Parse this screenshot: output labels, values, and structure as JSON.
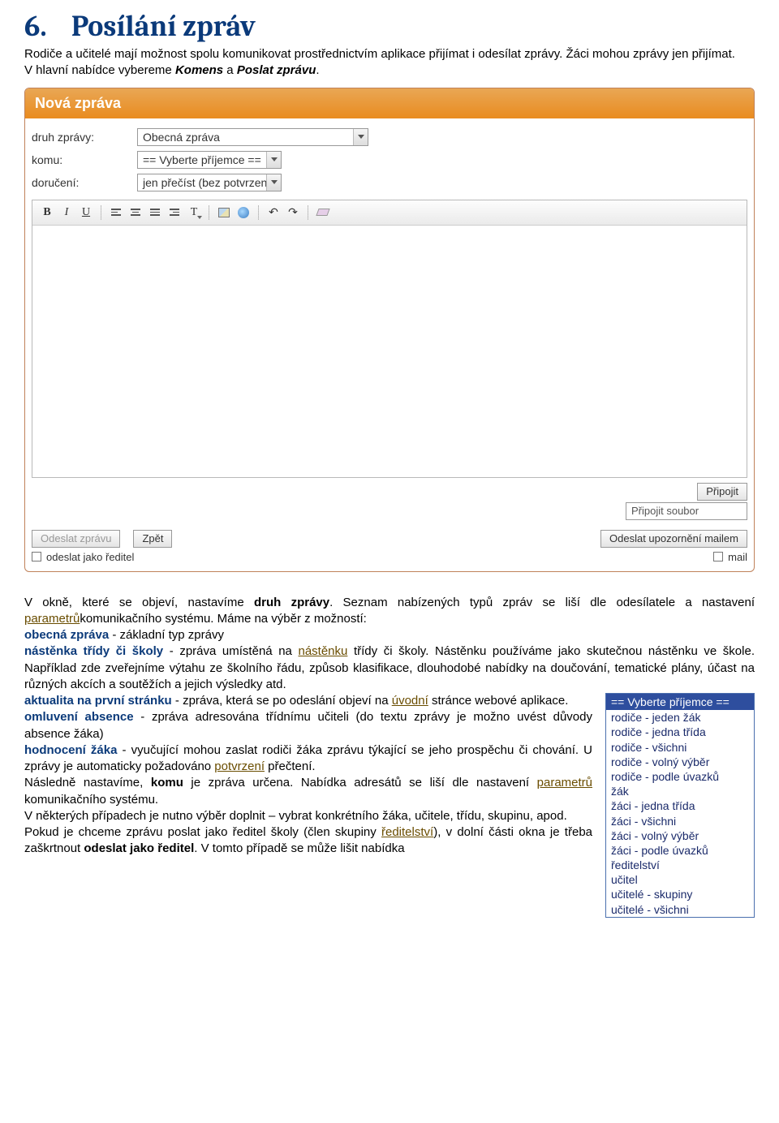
{
  "heading": {
    "number": "6.",
    "title": "Posílání zpráv"
  },
  "intro": {
    "p1a": "Rodiče a učitelé mají možnost spolu komunikovat prostřednictvím aplikace přijímat i odesílat zprávy. Žáci mohou zprávy jen přijímat.",
    "p1b_prefix": "V hlavní nabídce vybereme ",
    "p1b_bold1": "Komens",
    "p1b_mid": " a ",
    "p1b_bold2": "Poslat zprávu",
    "p1b_suffix": "."
  },
  "app": {
    "header_title": "Nová zpráva",
    "labels": {
      "druh": "druh zprávy:",
      "komu": "komu:",
      "doruceni": "doručení:"
    },
    "values": {
      "druh": "Obecná zpráva",
      "komu": "== Vyberte příjemce ==",
      "doruceni": "jen přečíst (bez potvrzení"
    },
    "toolbar": {
      "bold": "B",
      "italic": "I",
      "underline": "U",
      "text_style": "T",
      "undo": "↶",
      "redo": "↷"
    },
    "attach": {
      "btn": "Připojit",
      "field": "Připojit soubor"
    },
    "bottom": {
      "send": "Odeslat zprávu",
      "back": "Zpět",
      "as_director": "odeslat jako ředitel",
      "send_mail": "Odeslat upozornění mailem",
      "mail": "mail"
    }
  },
  "explain": {
    "l1a": "V okně, které se objeví, nastavíme ",
    "l1b": "druh zprávy",
    "l1c": ". Seznam nabízených typů zpráv se liší dle odesílatele a nastavení ",
    "l1d": "parametrů",
    "l1e": "komunikačního systému. Máme na výběr z možností:",
    "obecna_b": "obecná zpráva",
    "obecna_t": " - základní typ zprávy",
    "nastenka_b": "nástěnka třídy či školy",
    "nastenka_t1": " - zpráva umístěná na ",
    "nastenka_l": "nástěnku",
    "nastenka_t2": " třídy či školy. Nástěnku používáme jako skutečnou nástěnku ve škole. Například zde zveřejníme výtahu ze školního řádu, způsob klasifikace, dlouhodobé nabídky na doučování, tematické plány, účast na různých akcích a soutěžích a jejich výsledky atd.",
    "aktual_b": "aktualita na první stránku",
    "aktual_t1": " - zpráva, která se po odeslání objeví na ",
    "aktual_l": "úvodní",
    "aktual_t2": " stránce webové aplikace.",
    "omluv_b": "omluvení absence",
    "omluv_t": " - zpráva adresována třídnímu učiteli (do textu zprávy je možno uvést důvody absence žáka)",
    "hodn_b": "hodnocení žáka",
    "hodn_t1": " - vyučující mohou zaslat rodiči žáka zprávu týkající se jeho prospěchu či chování. U zprávy je automaticky požadováno ",
    "hodn_l": "potvrzení",
    "hodn_t2": " přečtení.",
    "nasl_t1": "Následně nastavíme, ",
    "nasl_b": "komu",
    "nasl_t2": " je zpráva určena. Nabídka adresátů se liší dle nastavení ",
    "nasl_l": "parametrů",
    "nasl_t3": " komunikačního systému.",
    "nekt": "V některých případech je nutno výběr doplnit – vybrat konkrétního žáka, učitele, třídu, skupinu, apod.",
    "pokud_t1": "Pokud je chceme zprávu poslat jako ředitel školy (člen skupiny ",
    "pokud_l": "ředitelství",
    "pokud_t2": "), v dolní části okna je třeba zaškrtnout ",
    "pokud_b": "odeslat jako ředitel",
    "pokud_t3": ". V tomto případě se může lišit nabídka"
  },
  "recipients": {
    "selected": "== Vyberte příjemce ==",
    "opts": [
      "rodiče - jeden žák",
      "rodiče - jedna třída",
      "rodiče - všichni",
      "rodiče - volný výběr",
      "rodiče - podle úvazků",
      "žák",
      "žáci - jedna třída",
      "žáci - všichni",
      "žáci - volný výběr",
      "žáci - podle úvazků",
      "ředitelství",
      "učitel",
      "učitelé - skupiny",
      "učitelé - všichni"
    ]
  }
}
